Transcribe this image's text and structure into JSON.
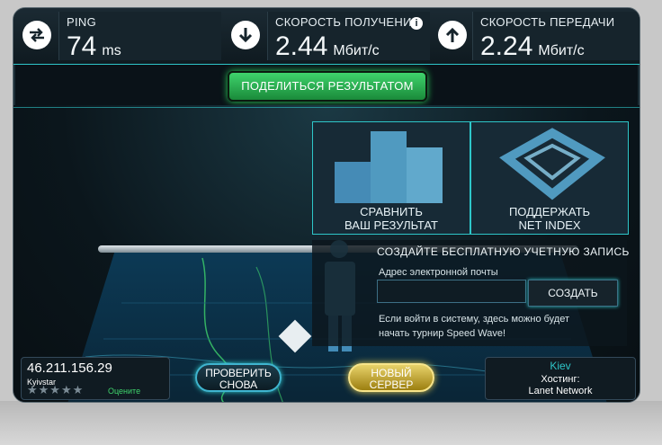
{
  "stats": {
    "ping": {
      "label": "PING",
      "value": "74",
      "unit": "ms"
    },
    "download": {
      "label": "СКОРОСТЬ ПОЛУЧЕНИЯ",
      "value": "2.44",
      "unit": "Мбит/с",
      "info": "i"
    },
    "upload": {
      "label": "СКОРОСТЬ ПЕРЕДАЧИ",
      "value": "2.24",
      "unit": "Мбит/с"
    }
  },
  "share_button": "ПОДЕЛИТЬСЯ РЕЗУЛЬТАТОМ",
  "tiles": {
    "compare": {
      "line1": "СРАВНИТЬ",
      "line2": "ВАШ РЕЗУЛЬТАТ"
    },
    "support": {
      "line1": "ПОДДЕРЖАТЬ",
      "line2": "NET INDEX"
    }
  },
  "signup": {
    "title": "СОЗДАЙТЕ БЕСПЛАТНУЮ УЧЕТНУЮ ЗАПИСЬ",
    "email_label": "Адрес электронной почты",
    "email_value": "",
    "create_button": "СОЗДАТЬ",
    "note": "Если войти в систему, здесь можно будет начать турнир Speed Wave!"
  },
  "connection": {
    "ip": "46.211.156.29",
    "isp": "Kyivstar",
    "rate_label": "Оцените",
    "stars": "★★★★★"
  },
  "buttons": {
    "retest_line1": "ПРОВЕРИТЬ",
    "retest_line2": "СНОВА",
    "newserver_line1": "НОВЫЙ",
    "newserver_line2": "СЕРВЕР"
  },
  "server": {
    "city": "Kiev",
    "hosting_label": "Хостинг:",
    "provider": "Lanet Network"
  },
  "colors": {
    "accent": "#2ec6c9",
    "share": "#3fd36c",
    "newserver": "#e5cd50"
  }
}
